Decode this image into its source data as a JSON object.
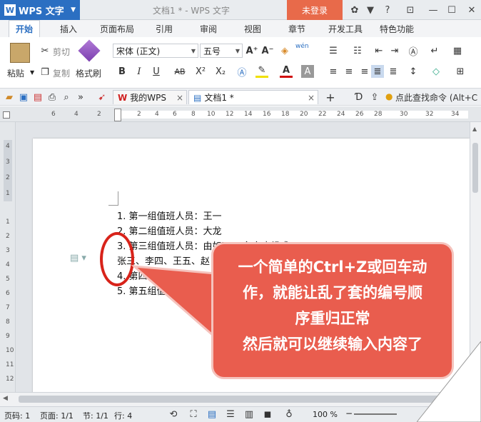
{
  "app": {
    "name": "WPS 文字",
    "logo": "W",
    "window_title": "文档1 * - WPS 文字",
    "login": "未登录",
    "help": "?"
  },
  "ribbon_tabs": [
    "开始",
    "插入",
    "页面布局",
    "引用",
    "审阅",
    "视图",
    "章节",
    "开发工具",
    "特色功能"
  ],
  "clipboard": {
    "paste": "粘贴",
    "cut": "剪切",
    "copy": "复制",
    "format_painter": "格式刷"
  },
  "font": {
    "family": "宋体 (正文)",
    "size": "五号"
  },
  "format_buttons": {
    "bold": "B",
    "italic": "I",
    "underline": "U",
    "strike": "AB",
    "superscript": "X²",
    "subscript": "X₂",
    "grow": "A⁺",
    "shrink": "A⁻",
    "color_a": "A",
    "wen": "wén"
  },
  "doc_tabs": {
    "my_wps": "我的WPS",
    "doc": "文档1 *",
    "add": "+"
  },
  "command_search": "点此查找命令 (Alt+C",
  "ruler_h": [
    "6",
    "4",
    "2",
    "2",
    "4",
    "6",
    "8",
    "10",
    "12",
    "14",
    "16",
    "18",
    "20",
    "22",
    "24",
    "26",
    "28",
    "30",
    "32",
    "34"
  ],
  "ruler_v": [
    "4",
    "3",
    "2",
    "1",
    "1",
    "2",
    "3",
    "4",
    "5",
    "6",
    "7",
    "8",
    "9",
    "10",
    "11",
    "12"
  ],
  "document_lines": [
    "1. 第一组值班人员：王一",
    "2. 第二组值班人员：大龙",
    "3. 第三组值班人员：由如下 3 名家庭组成",
    "张三、李四、王五、赵",
    "4. 第四组值班人员：",
    "5. 第五组值班人"
  ],
  "callout": {
    "lines": [
      "一个简单的Ctrl+Z或回车动",
      "作，就能让乱了套的编号顺",
      "序重归正常",
      "然后就可以继续输入内容了"
    ]
  },
  "status": {
    "page": "页码: 1",
    "pages": "页面: 1/1",
    "section": "节: 1/1",
    "row": "行: 4",
    "zoom": "100 %",
    "zoom_minus": "−"
  },
  "colors": {
    "accent": "#2b6fc2",
    "login": "#e86a4a",
    "callout": "#e95d4e",
    "circle": "#d8231a"
  }
}
